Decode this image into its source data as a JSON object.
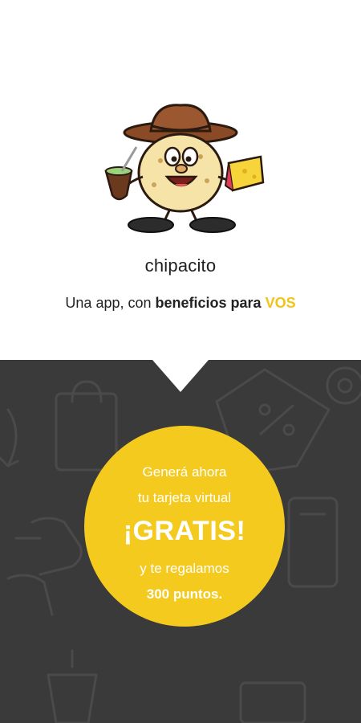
{
  "header": {
    "app_name": "chipacito",
    "tagline_prefix": "Una app, con ",
    "tagline_bold": "beneficios para ",
    "tagline_accent": "VOS"
  },
  "promo": {
    "line1": "Generá ahora",
    "line2": "tu tarjeta virtual",
    "headline": "¡GRATIS!",
    "line3": "y te regalamos",
    "line4": "300 puntos."
  },
  "colors": {
    "accent": "#f2c417",
    "dark_bg": "#3a3a3a",
    "circle": "#f4ca1f"
  },
  "icons": [
    "mascot-chipa-icon",
    "mate-icon",
    "cheese-icon"
  ]
}
